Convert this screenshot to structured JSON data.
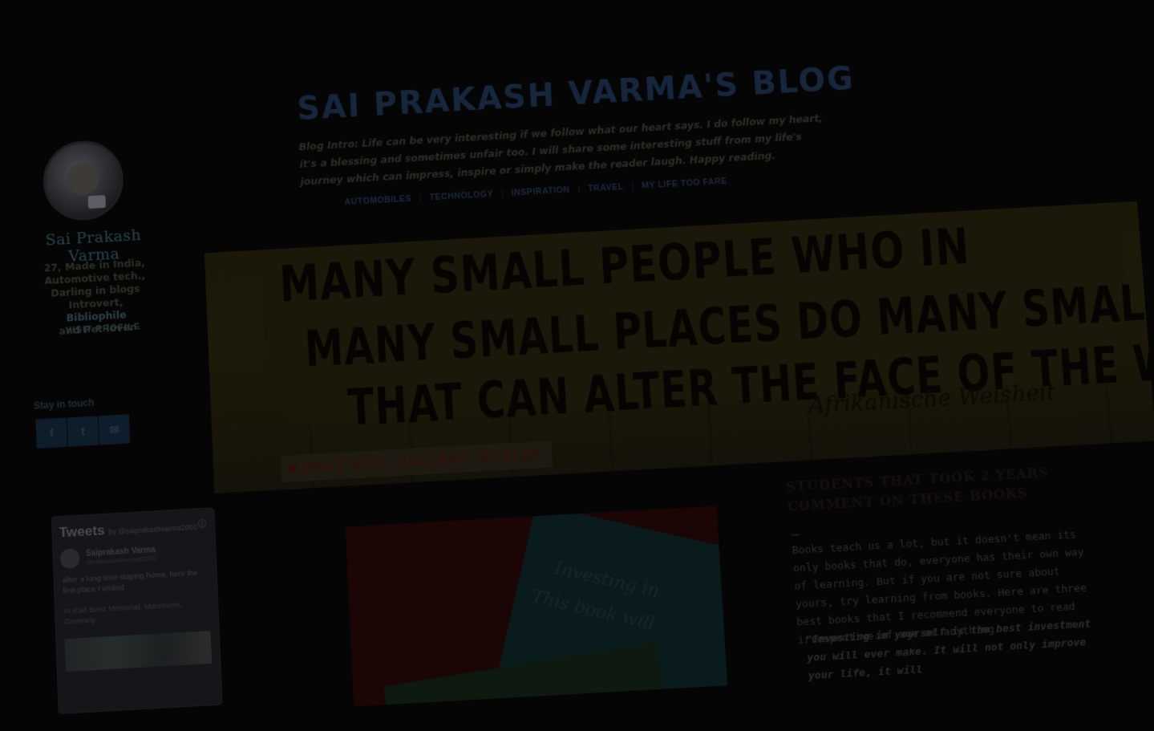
{
  "sidebar": {
    "author_name": "Sai Prakash Varma",
    "bio_line1": "27, Made in India,",
    "bio_line2": "Automotive tech.,",
    "bio_line3": "Darling in blogs",
    "bio_line4_a": "Introvert,",
    "bio_line4_b": "Bibliophile",
    "bio_line5": "and Pet lover",
    "view_profile": "VISIT PROFILE",
    "stay_label": "Stay in touch",
    "social": [
      "f",
      "t",
      "✉"
    ]
  },
  "tweets": {
    "title": "Tweets",
    "by": "by @saiprakashvarma2000",
    "info": "ⓘ",
    "user_name": "Saiprakash Varma",
    "user_handle": "@saiprakashvarma2000",
    "text": "after a long time staying home, here the first place I visited.",
    "location": "At Karl Benz Memorial, Mannheim, Germany"
  },
  "header": {
    "title": "SAI PRAKASH VARMA'S BLOG",
    "intro": "Blog Intro: Life can be very interesting if we follow what our heart says. I do follow my heart, it's a blessing and sometimes unfair too. I will share some interesting stuff from my life's journey which can impress, inspire or simply make the reader laugh. Happy reading.",
    "nav": [
      "AUTOMOBILES",
      "TECHNOLOGY",
      "INSPIRATION",
      "TRAVEL",
      "MY LIFE TOO FARE"
    ],
    "nav_sep": "|"
  },
  "banner": {
    "line1": "MANY SMALL PEOPLE WHO IN",
    "line2": "MANY SMALL PLACES DO MANY SMALLTHINGS",
    "line3": "THAT CAN ALTER THE FACE OF THE WORLD",
    "signature": "Afrikanische Weisheit",
    "location": "EAST SIDE GALLERY, BERLIN"
  },
  "post": {
    "image_card_line1": "Investing in",
    "image_card_line2": "This book will",
    "title": "STUDENTS THAT TOOK 2 YEARS COMMENT ON THESE BOOKS",
    "body": "Books teach us a lot, but it doesn't mean its only books that do, everyone has their own way of learning. But if you are not sure about yours, try learning from books. Here are three best books that I recommend everyone to read irrespective of age or anything.",
    "quote": "\"Investing in yourself is the best investment you will ever make. It will not only improve your life, it will"
  },
  "colors": {
    "background": "#050506",
    "title": "#16263c",
    "banner": "#1c1809"
  }
}
